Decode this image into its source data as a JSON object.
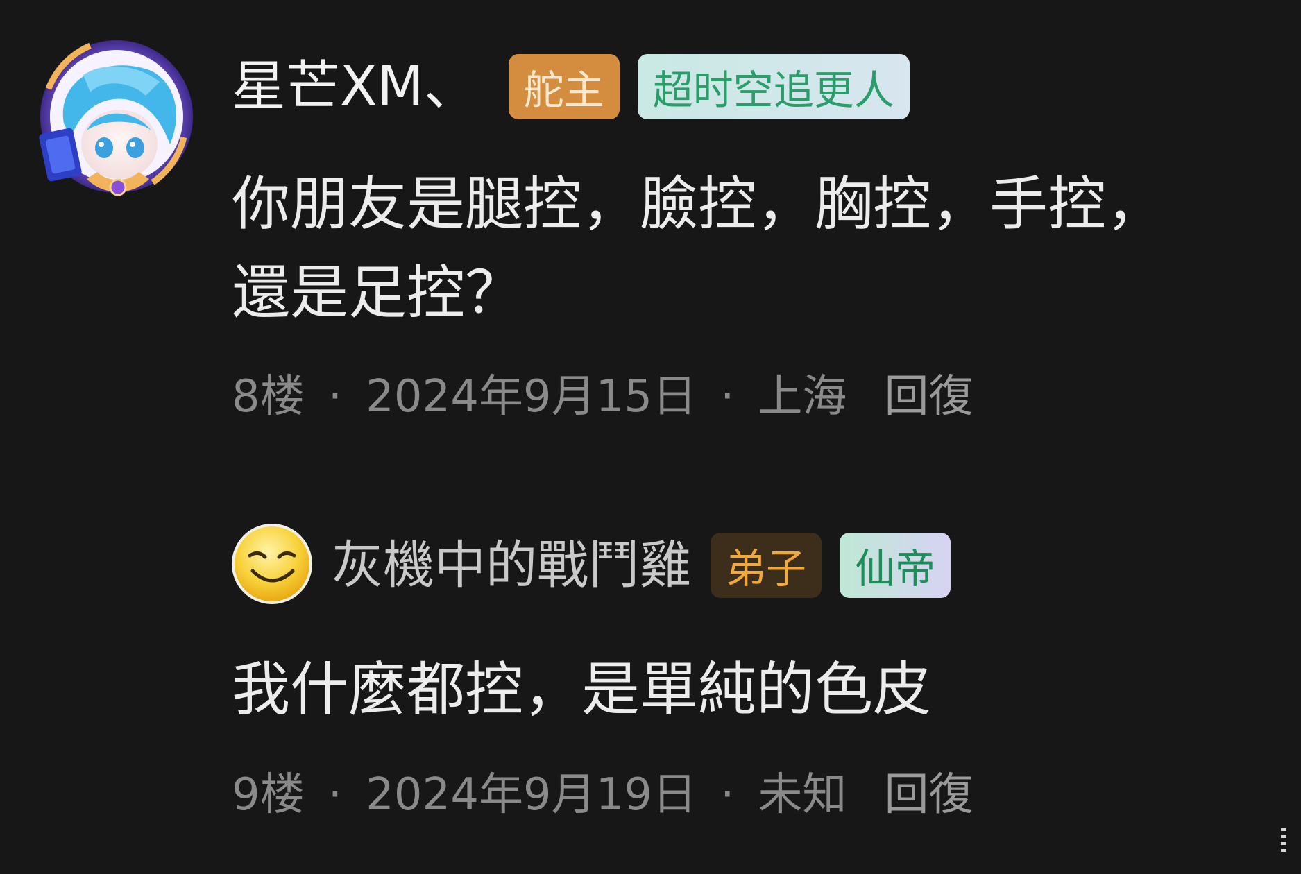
{
  "comments": [
    {
      "username": "星芒XM、",
      "badges": [
        "舵主",
        "超时空追更人"
      ],
      "body_lines": [
        "你朋友是腿控，臉控，胸控，手控，",
        "還是足控？"
      ],
      "floor": "8楼",
      "date": "2024年9月15日",
      "location": "上海",
      "reply_label": "回復",
      "separator": "·",
      "avatar_icon": "anime-girl-avatar-frame"
    },
    {
      "username": "灰機中的戰鬥雞",
      "badges": [
        "弟子",
        "仙帝"
      ],
      "body_lines": [
        "我什麼都控，是單純的色皮"
      ],
      "floor": "9楼",
      "date": "2024年9月19日",
      "location": "未知",
      "reply_label": "回復",
      "separator": "·",
      "avatar_icon": "smirk-emoji-avatar"
    }
  ],
  "colors": {
    "background": "#171717",
    "badge_orange": "#d48c3f",
    "badge_teal_text": "#2a9d6a",
    "badge_brown": "#3d2e1c",
    "badge_brown_text": "#f0a93c",
    "meta_text": "#8a8a8a"
  }
}
